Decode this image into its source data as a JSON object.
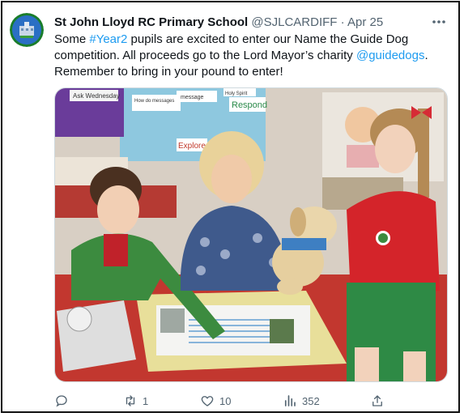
{
  "tweet": {
    "author_name": "St John Lloyd RC Primary School",
    "author_handle": "@SJLCARDIFF",
    "separator": "·",
    "date": "Apr 25",
    "more_icon": "more-horizontal-icon",
    "text_parts": {
      "p1": "Some ",
      "hashtag": "#Year2",
      "p2": " pupils are excited to enter our Name the Guide Dog competition. All proceeds go to the Lord Mayor’s charity ",
      "mention": "@guidedogs",
      "p3": ". Remember to bring in your pound to enter!"
    },
    "link_color": "#1d9bf0"
  },
  "photo_labels": {
    "ask": "Ask Wednesday",
    "message": "message",
    "how": "How do messages",
    "holy": "Holy Spirit",
    "respond": "Respond",
    "explore": "Explore"
  },
  "actions": {
    "reply": {
      "icon": "reply-icon",
      "count": ""
    },
    "retweet": {
      "icon": "retweet-icon",
      "count": "1"
    },
    "like": {
      "icon": "heart-icon",
      "count": "10"
    },
    "views": {
      "icon": "views-bar-chart-icon",
      "count": "352"
    },
    "share": {
      "icon": "share-icon",
      "count": ""
    }
  }
}
